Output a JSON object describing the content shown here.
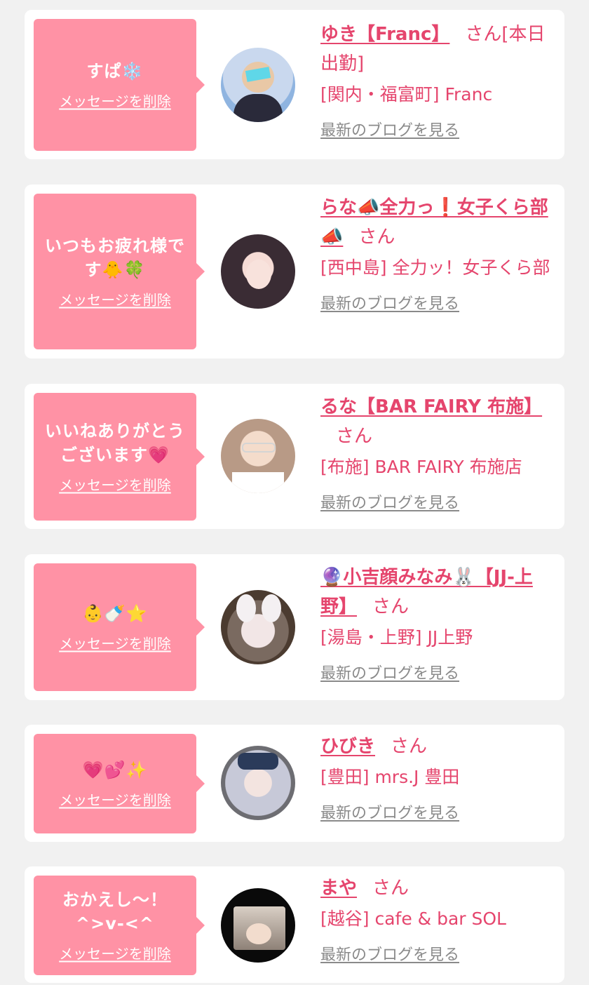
{
  "delete_label": "メッセージを削除",
  "blog_label": "最新のブログを見る",
  "san_label": "さん",
  "items": [
    {
      "message": "すぱ❄️",
      "name": "ゆき【Franc】",
      "name_suffix": "[本日出勤]",
      "shop": "[関内・福富町] Franc"
    },
    {
      "message": "いつもお疲れ様です🐥🍀",
      "name": "らな📣全力っ❗女子くら部📣",
      "name_suffix": "",
      "shop": "[西中島] 全力ッ！女子くら部"
    },
    {
      "message": "いいねありがとうございます💗",
      "name": "るな【BAR FAIRY 布施】",
      "name_suffix": "",
      "shop": "[布施] BAR FAIRY 布施店"
    },
    {
      "message": "👶🍼⭐",
      "name": "🔮小吉顔みなみ🐰【JJ-上野】",
      "name_suffix": "",
      "shop": "[湯島・上野] JJ上野"
    },
    {
      "message": "💗💕✨",
      "name": "ひびき",
      "name_suffix": "",
      "shop": "[豊田] mrs.J 豊田"
    },
    {
      "message": "おかえし〜！^>v-<^",
      "name": "まや",
      "name_suffix": "",
      "shop": "[越谷] cafe & bar SOL"
    }
  ],
  "colors": {
    "accent": "#e5456d",
    "bubble": "#ff92a5",
    "link_gray": "#8a8a8a",
    "background": "#f1f1f1"
  }
}
